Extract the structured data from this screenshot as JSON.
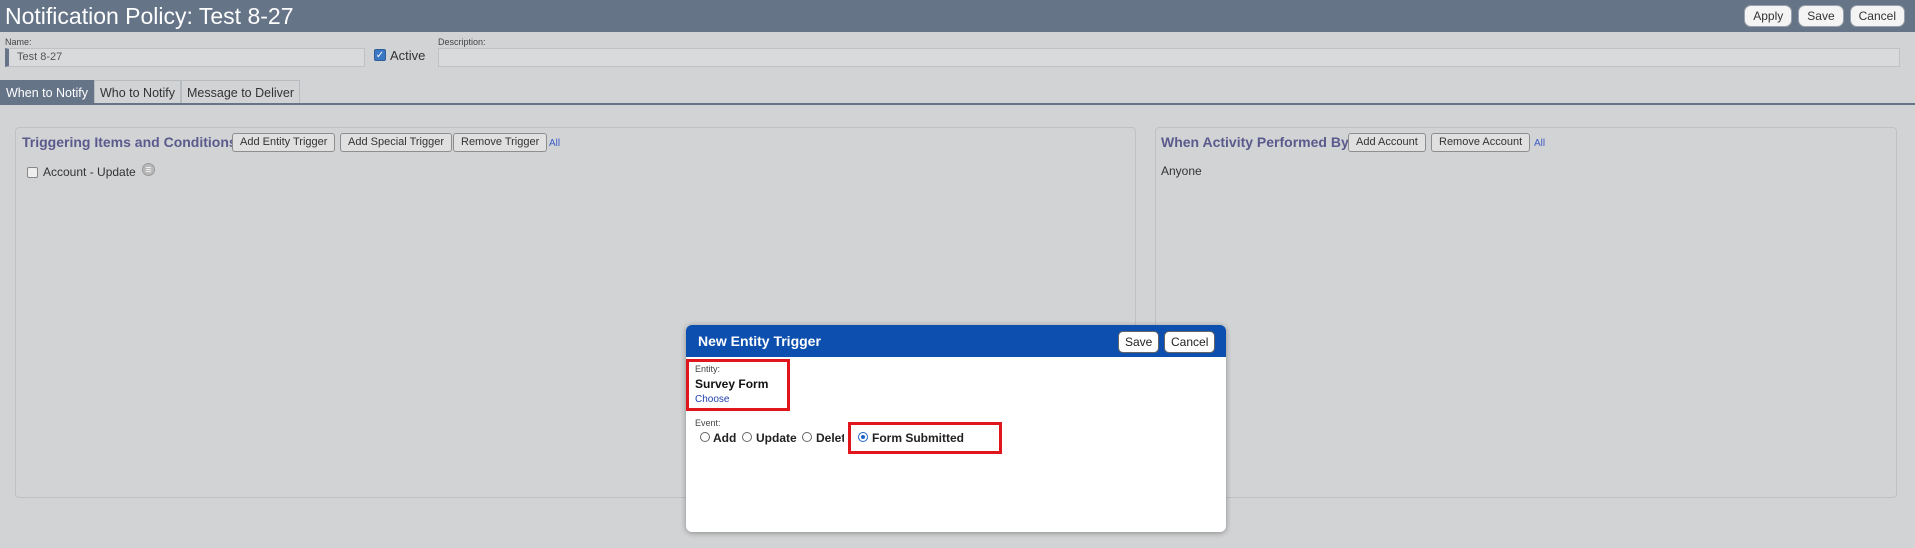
{
  "header": {
    "title": "Notification Policy: Test 8-27",
    "apply_label": "Apply",
    "save_label": "Save",
    "cancel_label": "Cancel"
  },
  "form": {
    "name_label": "Name:",
    "name_value": "Test 8-27",
    "active_label": "Active",
    "active_checked": true,
    "description_label": "Description:",
    "description_value": ""
  },
  "tabs": [
    {
      "label": "When to Notify",
      "active": true
    },
    {
      "label": "Who to Notify",
      "active": false
    },
    {
      "label": "Message to Deliver",
      "active": false
    }
  ],
  "triggers_panel": {
    "title": "Triggering Items and Conditions",
    "add_entity_label": "Add Entity Trigger",
    "add_special_label": "Add Special Trigger",
    "remove_label": "Remove Trigger",
    "all_label": "All",
    "items": [
      {
        "label": "Account - Update",
        "checked": false
      }
    ]
  },
  "activity_panel": {
    "title": "When Activity Performed By",
    "add_label": "Add Account",
    "remove_label": "Remove Account",
    "all_label": "All",
    "value": "Anyone"
  },
  "modal": {
    "title": "New Entity Trigger",
    "save_label": "Save",
    "cancel_label": "Cancel",
    "entity_label": "Entity:",
    "entity_value": "Survey Form",
    "choose_label": "Choose",
    "event_label": "Event:",
    "events": [
      {
        "label": "Add",
        "selected": false
      },
      {
        "label": "Update",
        "selected": false
      },
      {
        "label": "Delete",
        "selected": false
      },
      {
        "label": "Form Submitted",
        "selected": true
      }
    ],
    "highlight_color": "#e0161c",
    "header_color": "#0d4fae"
  },
  "colors": {
    "accent": "#667488",
    "title_text": "#5a5a8c",
    "link": "#3c5ec6"
  }
}
